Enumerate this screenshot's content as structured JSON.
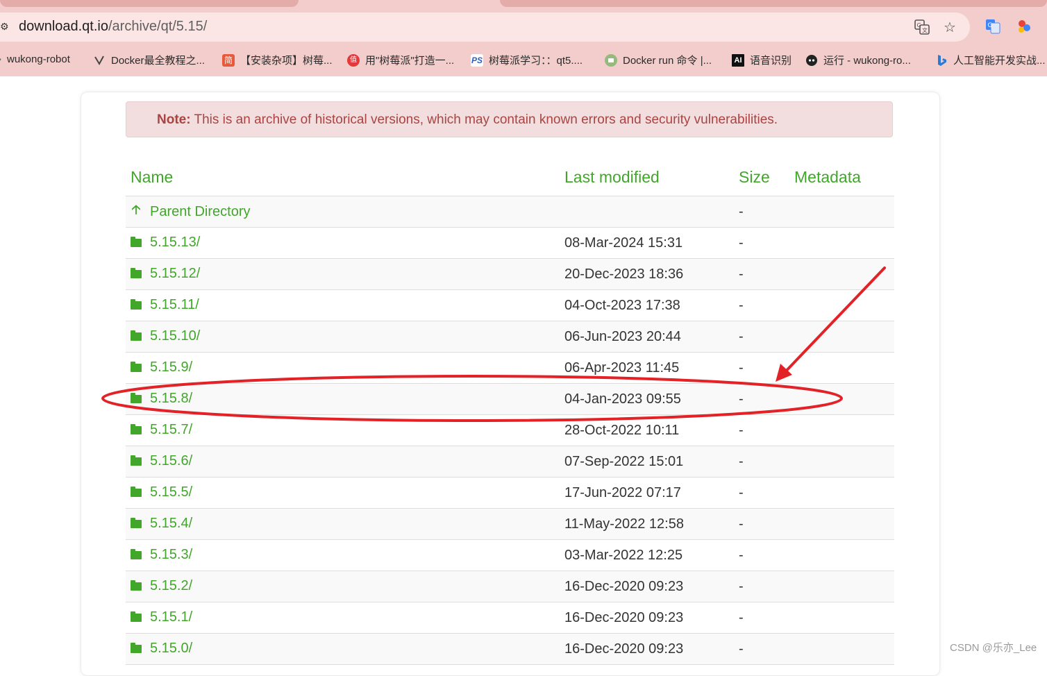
{
  "browser": {
    "url_host": "download.qt.io",
    "url_path": "/archive/qt/5.15/",
    "bookmarks": [
      {
        "label": "wukong-robot",
        "icon": "wukong-icon"
      },
      {
        "label": "Docker最全教程之...",
        "icon": "docker-icon"
      },
      {
        "label": "【安装杂项】树莓...",
        "icon": "jian-icon",
        "icon_text": "简"
      },
      {
        "label": "用\"树莓派\"打造一...",
        "icon": "zhi-icon",
        "icon_text": "值"
      },
      {
        "label": "树莓派学习：：qt5....",
        "icon": "ps-icon",
        "icon_text": "PS"
      },
      {
        "label": "Docker run 命令 |...",
        "icon": "runoob-icon"
      },
      {
        "label": "语音识别",
        "icon": "ai-icon",
        "icon_text": "AI"
      },
      {
        "label": "运行 - wukong-ro...",
        "icon": "github-icon"
      },
      {
        "label": "人工智能开发实战...",
        "icon": "bing-icon"
      }
    ]
  },
  "note": {
    "label": "Note:",
    "text": " This is an archive of historical versions, which may contain known errors and security vulnerabilities."
  },
  "table": {
    "headers": {
      "name": "Name",
      "modified": "Last modified",
      "size": "Size",
      "metadata": "Metadata"
    },
    "parent": {
      "name": "Parent Directory",
      "size": "-"
    },
    "rows": [
      {
        "name": "5.15.13/",
        "modified": "08-Mar-2024 15:31",
        "size": "-"
      },
      {
        "name": "5.15.12/",
        "modified": "20-Dec-2023 18:36",
        "size": "-"
      },
      {
        "name": "5.15.11/",
        "modified": "04-Oct-2023 17:38",
        "size": "-"
      },
      {
        "name": "5.15.10/",
        "modified": "06-Jun-2023 20:44",
        "size": "-"
      },
      {
        "name": "5.15.9/",
        "modified": "06-Apr-2023 11:45",
        "size": "-"
      },
      {
        "name": "5.15.8/",
        "modified": "04-Jan-2023 09:55",
        "size": "-"
      },
      {
        "name": "5.15.7/",
        "modified": "28-Oct-2022 10:11",
        "size": "-"
      },
      {
        "name": "5.15.6/",
        "modified": "07-Sep-2022 15:01",
        "size": "-"
      },
      {
        "name": "5.15.5/",
        "modified": "17-Jun-2022 07:17",
        "size": "-"
      },
      {
        "name": "5.15.4/",
        "modified": "11-May-2022 12:58",
        "size": "-"
      },
      {
        "name": "5.15.3/",
        "modified": "03-Mar-2022 12:25",
        "size": "-"
      },
      {
        "name": "5.15.2/",
        "modified": "16-Dec-2020 09:23",
        "size": "-"
      },
      {
        "name": "5.15.1/",
        "modified": "16-Dec-2020 09:23",
        "size": "-"
      },
      {
        "name": "5.15.0/",
        "modified": "16-Dec-2020 09:23",
        "size": "-"
      }
    ]
  },
  "watermark": "CSDN @乐亦_Lee",
  "colors": {
    "link_green": "#41a62a",
    "note_text": "#a94442",
    "note_bg": "#f2dede",
    "annotation_red": "#e32227",
    "chrome_bg": "#f3cdcb"
  }
}
